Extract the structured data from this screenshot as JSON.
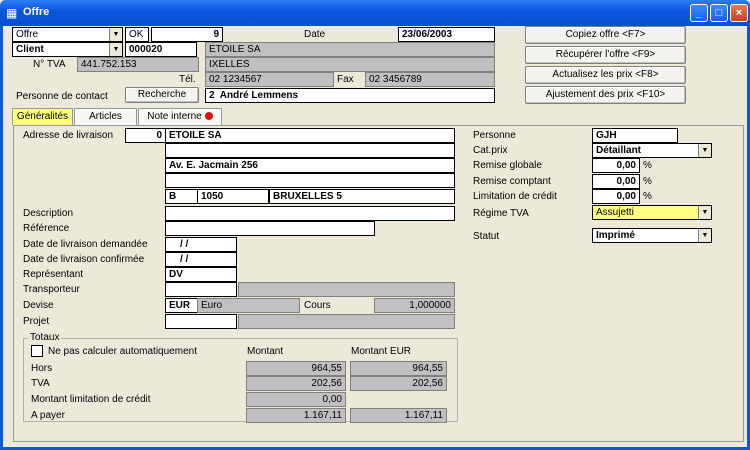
{
  "window": {
    "title": "Offre",
    "app_icon": "grid-icon"
  },
  "header": {
    "doc_type": "Offre",
    "status_code": "OK",
    "doc_number": "9",
    "date_label": "Date",
    "date_value": "23/06/2003",
    "party_type": "Client",
    "client_code": "000020",
    "client_name": "ETOILE SA",
    "client_city": "IXELLES",
    "tva_label": "N° TVA",
    "tva_value": "441.752.153",
    "tel_label": "Tél.",
    "tel_value": "02 1234567",
    "fax_label": "Fax",
    "fax_value": "02 3456789",
    "contact_label": "Personne de contact",
    "search_button": "Recherche",
    "contact_number": "2",
    "contact_name": "André Lemmens"
  },
  "actions": {
    "copy": "Copiez offre <F7>",
    "recover": "Récupérer l'offre <F9>",
    "update_prices": "Actualisez les prix <F8>",
    "adjust_prices": "Ajustement des prix <F10>"
  },
  "tabs": {
    "general": "Généralités",
    "articles": "Articles",
    "note": "Note interne"
  },
  "form": {
    "delivery_label": "Adresse de livraison",
    "delivery_num": "0",
    "delivery_name": "ETOILE SA",
    "delivery_line2": "",
    "delivery_street": "Av. E. Jacmain 256",
    "delivery_line4": "",
    "delivery_country": "B",
    "delivery_zip": "1050",
    "delivery_city": "BRUXELLES 5",
    "description_label": "Description",
    "reference_label": "Référence",
    "date_requested_label": "Date de livraison demandée",
    "date_requested": "/ /",
    "date_confirmed_label": "Date de livraison confirmée",
    "date_confirmed": "/ /",
    "rep_label": "Représentant",
    "rep_value": "DV",
    "carrier_label": "Transporteur",
    "currency_label": "Devise",
    "currency_code": "EUR",
    "currency_name": "Euro",
    "rate_label": "Cours",
    "rate_value": "1,000000",
    "project_label": "Projet"
  },
  "side": {
    "person_label": "Personne",
    "person_value": "GJH",
    "price_cat_label": "Cat.prix",
    "price_cat_value": "Détaillant",
    "global_discount_label": "Remise globale",
    "global_discount_value": "0,00",
    "cash_discount_label": "Remise comptant",
    "cash_discount_value": "0,00",
    "credit_limit_label": "Limitation de crédit",
    "credit_limit_value": "0,00",
    "pct": "%",
    "vat_regime_label": "Régime TVA",
    "vat_regime_value": "Assujetti",
    "status_label": "Statut",
    "status_value": "Imprimé"
  },
  "totals": {
    "group_label": "Totaux",
    "auto_calc_label": "Ne pas calculer automatiquement",
    "col_amount": "Montant",
    "col_amount_eur": "Montant EUR",
    "excl_label": "Hors",
    "excl_amount": "964,55",
    "excl_eur": "964,55",
    "vat_label": "TVA",
    "vat_amount": "202,56",
    "vat_eur": "202,56",
    "credit_label": "Montant limitation de crédit",
    "credit_amount": "0,00",
    "pay_label": "A payer",
    "pay_amount": "1.167,11",
    "pay_eur": "1.167,11"
  },
  "colors": {
    "title_bar": "#0a59e0",
    "active_tab": "#ffff80",
    "highlight_field": "#ffff80"
  }
}
